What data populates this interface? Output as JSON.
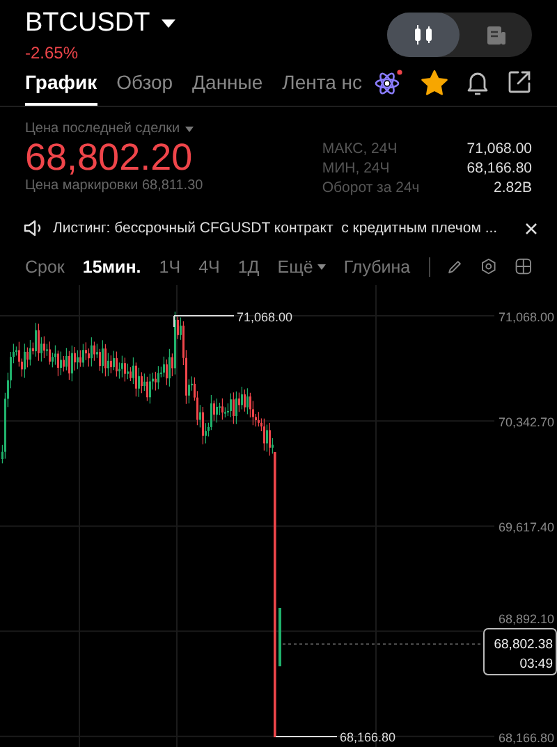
{
  "header": {
    "symbol": "BTCUSDT",
    "change": "-2.65%"
  },
  "view_toggle": [
    {
      "kind": "candles",
      "selected": true
    },
    {
      "kind": "document",
      "selected": false
    }
  ],
  "tabs": [
    {
      "label": "График",
      "selected": true
    },
    {
      "label": "Обзор",
      "selected": false
    },
    {
      "label": "Данные",
      "selected": false
    },
    {
      "label": "Лента нс",
      "selected": false
    }
  ],
  "favorite": true,
  "price": {
    "label": "Цена последней сделки",
    "last": "68,802.20",
    "mark": "Цена маркировки 68,811.30"
  },
  "stats": [
    {
      "label": "МАКС, 24Ч",
      "value": "71,068.00"
    },
    {
      "label": "МИН, 24Ч",
      "value": "68,166.80"
    },
    {
      "label": "Оборот за 24ч",
      "value": "2.82B"
    }
  ],
  "announcement": "Листинг: бессрочный CFGUSDT контракт  с кредитным плечом ...",
  "toolbar": {
    "caption": "Срок",
    "intervals": [
      {
        "label": "15мин.",
        "selected": true
      },
      {
        "label": "1Ч",
        "selected": false
      },
      {
        "label": "4Ч",
        "selected": false
      },
      {
        "label": "1Д",
        "selected": false
      }
    ],
    "more": "Ещё",
    "depth": "Глубина"
  },
  "chart": {
    "y_labels": [
      "71,068.00",
      "70,342.70",
      "69,617.40",
      "68,892.10",
      "68,166.80"
    ],
    "high_marker": "71,068.00",
    "low_marker": "68,166.80",
    "current_price": "68,802.38",
    "countdown": "03:49"
  }
}
